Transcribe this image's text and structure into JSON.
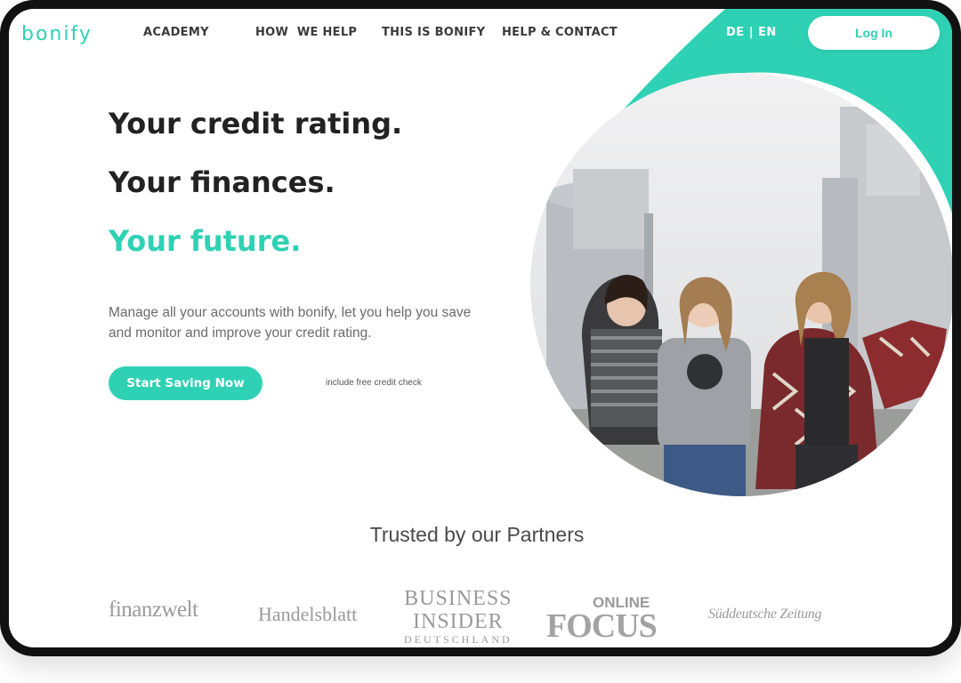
{
  "brand": {
    "logo_text": "bonify",
    "accent_color": "#2fd1b4"
  },
  "nav": {
    "links": [
      "ACADEMY",
      "HOW  WE HELP",
      "THIS IS BONIFY",
      "HELP & CONTACT"
    ],
    "lang_de": "DE",
    "lang_separator": "|",
    "lang_en": "EN",
    "login_label": "Log In"
  },
  "hero": {
    "line1": "Your credit rating.",
    "line2": "Your finances.",
    "line3": "Your future.",
    "description": "Manage all your accounts with bonify, let you help you save and monitor and improve your credit rating.",
    "cta_label": "Start Saving Now",
    "cta_note": "include free credit check"
  },
  "partners": {
    "title": "Trusted by our Partners",
    "finanzwelt": "finanzwelt",
    "handelsblatt": "Handelsblatt",
    "business_insider": [
      "BUSINESS",
      "INSIDER",
      "DEUTSCHLAND"
    ],
    "focus_online": [
      "ONLINE",
      "FOCUS"
    ],
    "sueddeutsche": "Süddeutsche Zeitung"
  }
}
